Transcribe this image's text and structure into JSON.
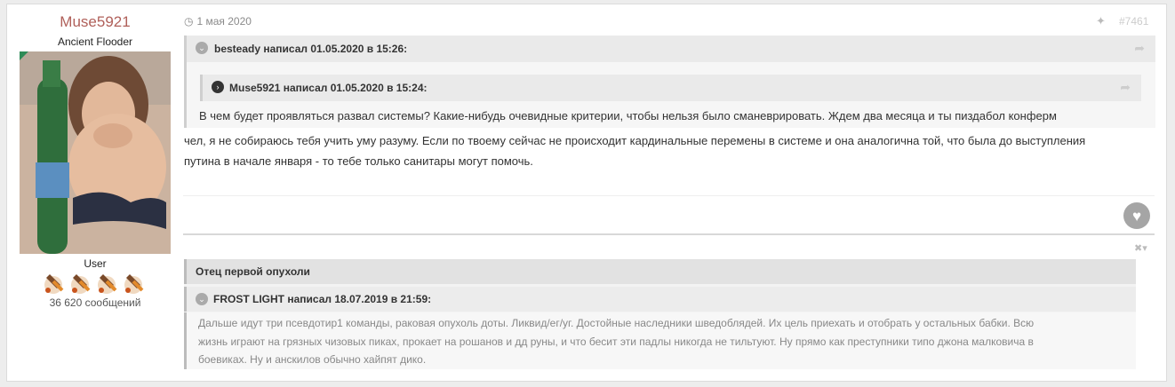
{
  "author": {
    "name": "Muse5921",
    "rank": "Ancient Flooder",
    "group": "User",
    "posts_count": "36 620 сообщений",
    "badge_count": 4
  },
  "post": {
    "date": "1 мая 2020",
    "number": "#7461",
    "quote_outer": {
      "header": "besteady написал 01.05.2020 в 15:26:",
      "inner_header": "Muse5921 написал 01.05.2020 в 15:24:",
      "text": "В чем будет проявляться развал системы? Какие-нибудь очевидные критерии, чтобы нельзя было сманеврировать. Ждем два месяца и ты пиздабол конферм"
    },
    "body_lines": [
      "чел, я не собираюсь тебя учить уму разуму. Если по твоему сейчас не происходит кардинальные перемены в системе и она аналогична той, что была до выступления",
      "путина в начале января - то тебе только санитары могут помочь."
    ]
  },
  "signature": {
    "title": "Отец первой опухоли",
    "quote_header": "FROST LIGHT написал 18.07.2019 в 21:59:",
    "quote_lines": [
      "Дальше идут три псевдотир1 команды, раковая опухоль доты. Ликвид/ег/уг. Достойные наследники шведоблядей. Их цель приехать и отобрать у остальных бабки. Всю",
      "жизнь играют на грязных чизовых пиках, прокает на рошанов и дд руны, и что бесит эти падлы никогда не тильтуют. Ну прямо как преступники типо джона малковича в",
      "боевиках. Ну и анскилов обычно хайпят дико."
    ]
  },
  "icons": {
    "clock": "clock-icon",
    "share": "share-icon",
    "reply": "reply-icon",
    "heart": "heart-icon",
    "toggle": "chevron-icon",
    "close": "close-icon"
  },
  "colors": {
    "author_name": "#b0605a",
    "badge_green": "#2e8b57"
  }
}
